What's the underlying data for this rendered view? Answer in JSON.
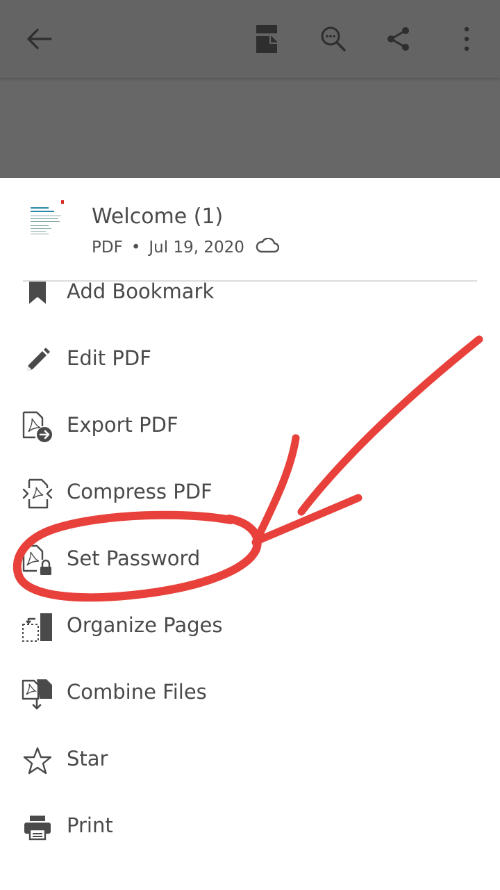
{
  "toolbar": {
    "back_icon": "arrow-left-icon",
    "icons": [
      "reading-mode-icon",
      "search-document-icon",
      "share-icon",
      "more-vertical-icon"
    ]
  },
  "file": {
    "title": "Welcome (1)",
    "type": "PDF",
    "separator": "•",
    "date": "Jul 19, 2020",
    "cloud_icon": "cloud-icon"
  },
  "menu": {
    "items": [
      {
        "label": "Add Bookmark",
        "icon": "bookmark-icon"
      },
      {
        "label": "Edit PDF",
        "icon": "pencil-icon"
      },
      {
        "label": "Export PDF",
        "icon": "export-pdf-icon"
      },
      {
        "label": "Compress PDF",
        "icon": "compress-pdf-icon"
      },
      {
        "label": "Set Password",
        "icon": "lock-pdf-icon"
      },
      {
        "label": "Organize Pages",
        "icon": "organize-pages-icon"
      },
      {
        "label": "Combine Files",
        "icon": "combine-files-icon"
      },
      {
        "label": "Star",
        "icon": "star-icon"
      },
      {
        "label": "Print",
        "icon": "printer-icon"
      }
    ]
  },
  "colors": {
    "scrim": "#676767",
    "annotation": "#e8403a",
    "text": "#4a4a4a"
  }
}
